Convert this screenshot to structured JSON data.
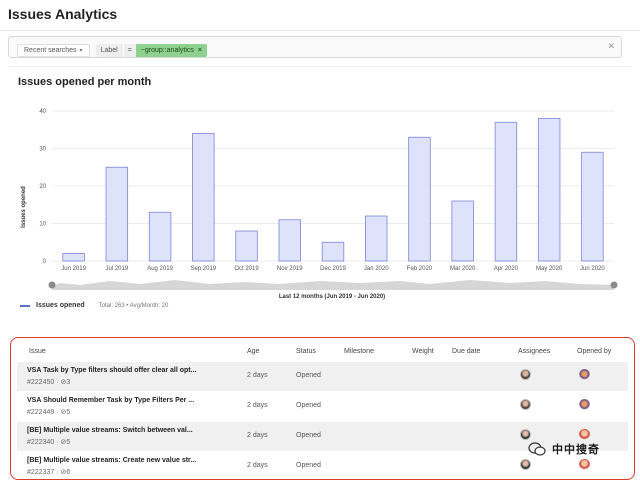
{
  "page": {
    "title": "Issues Analytics"
  },
  "filter": {
    "recent_label": "Recent searches",
    "token_key": "Label",
    "token_op": "=",
    "token_value": "~group::analytics",
    "token_remove_icon": "close-icon",
    "clear_icon": "close-icon"
  },
  "chart_section": {
    "title": "Issues opened per month",
    "legend_label": "Issues opened",
    "legend_stats": "Total: 263 • Avg/Month: 20",
    "range_label": "Last 12 months (Jun 2019 - Jun 2020)"
  },
  "chart_data": {
    "type": "bar",
    "title": "Issues opened per month",
    "xlabel": "Last 12 months (Jun 2019 - Jun 2020)",
    "ylabel": "Issues opened",
    "ylim": [
      0,
      40
    ],
    "yticks": [
      0,
      10,
      20,
      30,
      40
    ],
    "categories": [
      "Jun 2019",
      "Jul 2019",
      "Aug 2019",
      "Sep 2019",
      "Oct 2019",
      "Nov 2019",
      "Dec 2019",
      "Jan 2020",
      "Feb 2020",
      "Mar 2020",
      "Apr 2020",
      "May 2020",
      "Jun 2020"
    ],
    "series": [
      {
        "name": "Issues opened",
        "values": [
          2,
          25,
          13,
          34,
          8,
          11,
          5,
          12,
          33,
          16,
          37,
          38,
          29
        ]
      }
    ],
    "grid": true,
    "legend_position": "bottom-left",
    "colors": {
      "bar_fill": "#dfe2fb",
      "bar_stroke": "#7b86d6",
      "legend": "#5c6fc8"
    }
  },
  "table": {
    "columns": [
      "Issue",
      "Age",
      "Status",
      "Milestone",
      "Weight",
      "Due date",
      "Assignees",
      "Opened by"
    ],
    "rows": [
      {
        "title": "VSA Task by Type filters should offer clear all opt...",
        "meta": "#222450 · ⊘3",
        "age": "2 days",
        "status": "Opened"
      },
      {
        "title": "VSA Should Remember Task by Type Filters Per ...",
        "meta": "#222449 · ⊘5",
        "age": "2 days",
        "status": "Opened"
      },
      {
        "title": "[BE] Multiple value streams: Switch between val...",
        "meta": "#222340 · ⊘5",
        "age": "2 days",
        "status": "Opened"
      },
      {
        "title": "[BE] Multiple value streams: Create new value str...",
        "meta": "#222337 · ⊘6",
        "age": "2 days",
        "status": "Opened"
      }
    ]
  },
  "watermark": {
    "text": "中中搜奇"
  },
  "colors": {
    "highlight_border": "#e03a2e",
    "token_value_bg": "#8fd18f"
  }
}
